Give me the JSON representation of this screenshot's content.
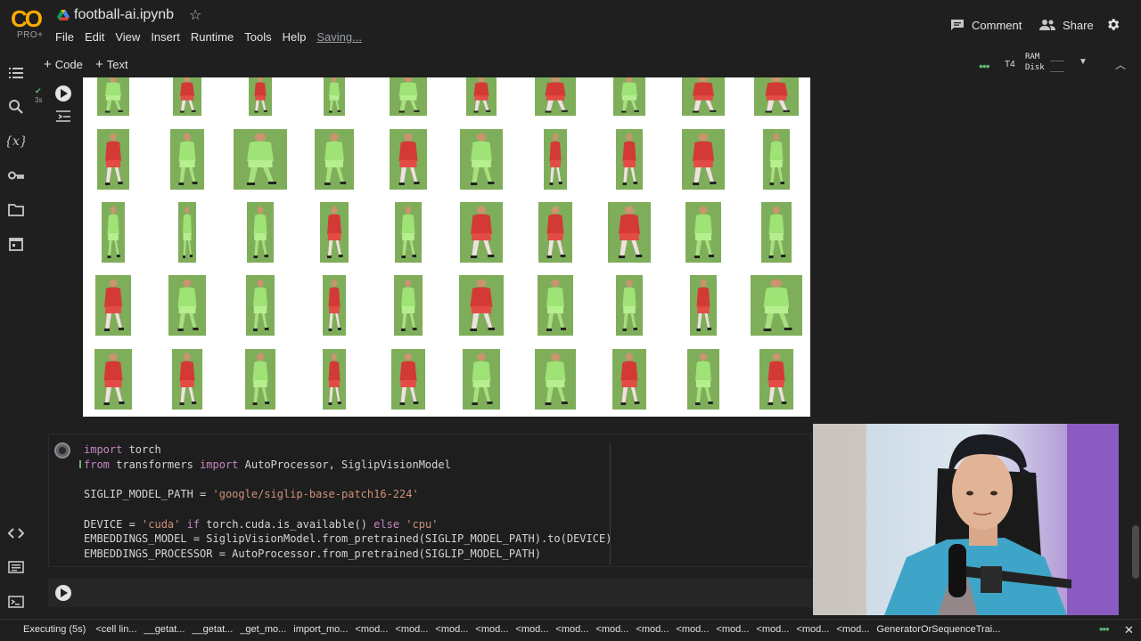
{
  "header": {
    "logo_letters": "CO",
    "logo_tier": "PRO+",
    "notebook_title": "football-ai.ipynb",
    "menu": [
      "File",
      "Edit",
      "View",
      "Insert",
      "Runtime",
      "Tools",
      "Help"
    ],
    "save_status": "Saving...",
    "comment_label": "Comment",
    "share_label": "Share"
  },
  "toolbar": {
    "add_code_label": "Code",
    "add_text_label": "Text",
    "runtime_type": "T4",
    "ram_label": "RAM",
    "disk_label": "Disk"
  },
  "cell_exec": {
    "exec_time": "3s"
  },
  "output": {
    "team_colors": {
      "red_team": "#d33a35",
      "green_team": "#9fe276"
    },
    "player_crop_rows": [
      [
        "green",
        "red",
        "red",
        "green",
        "green",
        "red",
        "red",
        "green",
        "red",
        "red"
      ],
      [
        "red",
        "green",
        "green",
        "green",
        "red",
        "green",
        "red",
        "red",
        "red",
        "green"
      ],
      [
        "green",
        "green",
        "green",
        "red",
        "green",
        "red",
        "red",
        "red",
        "green",
        "green"
      ],
      [
        "red",
        "green",
        "green",
        "red",
        "green",
        "red",
        "green",
        "green",
        "red",
        "green"
      ],
      [
        "red",
        "red",
        "green",
        "red",
        "red",
        "green",
        "green",
        "red",
        "green",
        "red"
      ]
    ]
  },
  "code_cell": {
    "lines": [
      "import torch",
      "from transformers import AutoProcessor, SiglipVisionModel",
      "",
      "SIGLIP_MODEL_PATH = 'google/siglip-base-patch16-224'",
      "",
      "DEVICE = 'cuda' if torch.cuda.is_available() else 'cpu'",
      "EMBEDDINGS_MODEL = SiglipVisionModel.from_pretrained(SIGLIP_MODEL_PATH).to(DEVICE)",
      "EMBEDDINGS_PROCESSOR = AutoProcessor.from_pretrained(SIGLIP_MODEL_PATH)"
    ]
  },
  "status_bar": {
    "executing": "Executing (5s)",
    "stack": [
      "<cell lin...",
      "__getat...",
      "__getat...",
      "_get_mo...",
      "import_mo...",
      "<mod...",
      "<mod...",
      "<mod...",
      "<mod...",
      "<mod...",
      "<mod...",
      "<mod...",
      "<mod...",
      "<mod...",
      "<mod...",
      "<mod...",
      "<mod...",
      "<mod...",
      "GeneratorOrSequenceTrai..."
    ]
  },
  "icons": [
    "drive-icon",
    "star-icon",
    "comment-icon",
    "share-icon",
    "gear-icon",
    "toc-icon",
    "search-icon",
    "variables-icon",
    "key-icon",
    "folder-icon",
    "calendar-icon",
    "code-snippets-icon",
    "command-palette-icon",
    "terminal-icon",
    "run-icon",
    "close-icon"
  ]
}
